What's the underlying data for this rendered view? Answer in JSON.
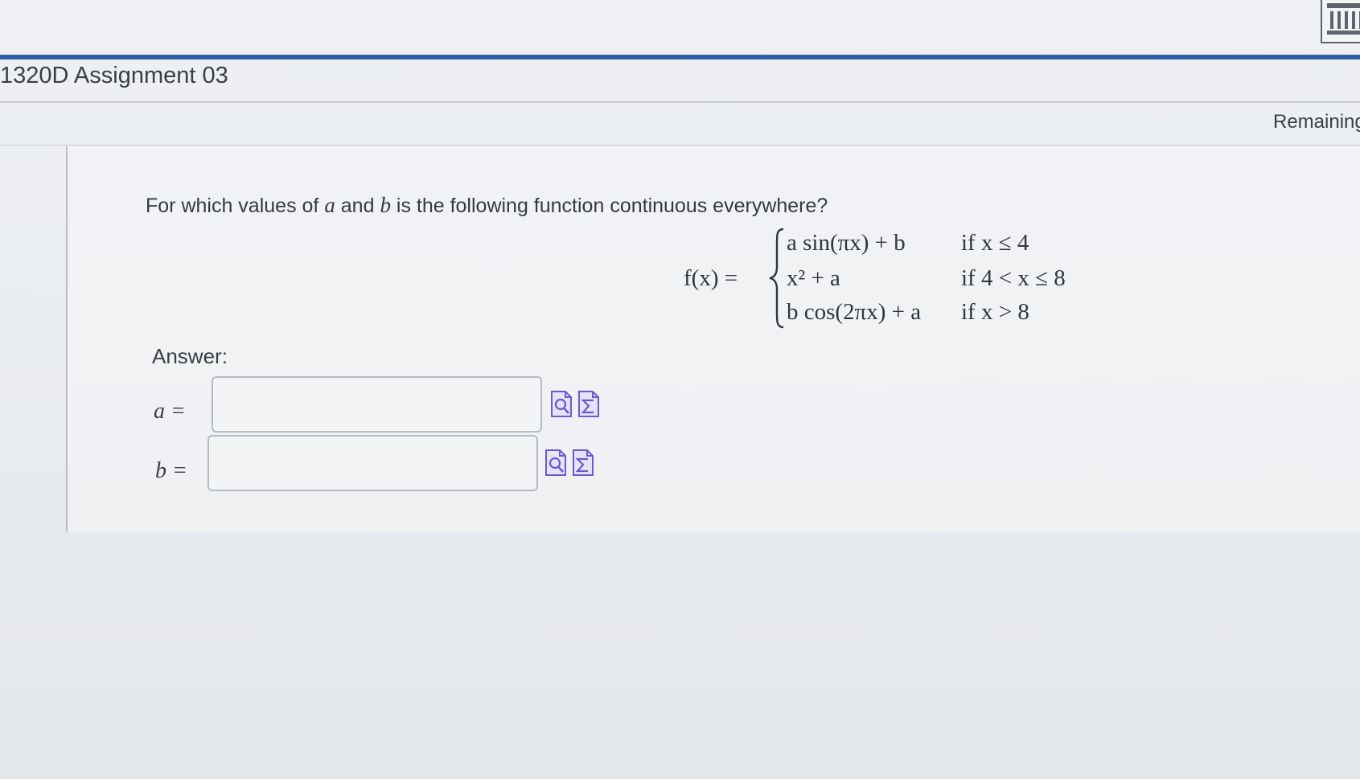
{
  "header": {
    "assignment_title": "1320D Assignment 03",
    "remaining_label": "Remaining"
  },
  "question": {
    "prompt_before_a": "For which values of ",
    "var_a": "a",
    "prompt_between": " and ",
    "var_b": "b",
    "prompt_after_b": " is the following function continuous everywhere?",
    "function_lhs": "f(x) =",
    "cases": [
      {
        "expression": "a sin(πx) + b",
        "condition": "if x ≤ 4"
      },
      {
        "expression": "x² + a",
        "condition": "if 4 < x ≤ 8"
      },
      {
        "expression": "b cos(2πx) + a",
        "condition": "if x > 8"
      }
    ]
  },
  "answer": {
    "label": "Answer:",
    "fields": [
      {
        "label": "a =",
        "value": ""
      },
      {
        "label": "b =",
        "value": ""
      }
    ]
  },
  "icons": {
    "header_right": "bank-icon",
    "preview": "preview-icon",
    "equation_editor": "sigma-icon"
  },
  "colors": {
    "accent_rule": "#2f5fa6",
    "icon_purple": "#6a5acd",
    "text": "#2f3640"
  }
}
